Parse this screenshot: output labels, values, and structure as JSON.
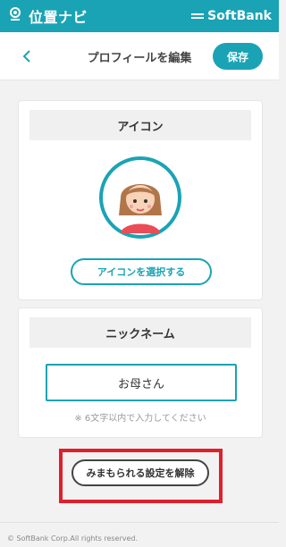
{
  "app_bar": {
    "brand": "位置ナビ",
    "partner": "SoftBank",
    "icons": {
      "pin": "location-pin-icon",
      "logo": "softbank-lines-icon"
    }
  },
  "header": {
    "back_icon": "chevron-left-icon",
    "title": "プロフィールを編集",
    "save_label": "保存"
  },
  "icon_section": {
    "heading": "アイコン",
    "avatar": "girl-avatar-icon",
    "select_label": "アイコンを選択する"
  },
  "nickname_section": {
    "heading": "ニックネーム",
    "value": "お母さん",
    "hint": "※ 6文字以内で入力してください"
  },
  "actions": {
    "unmonitor_label": "みまもられる設定を解除"
  },
  "footer": {
    "copyright": "© SoftBank Corp.All rights reserved."
  },
  "colors": {
    "accent": "#1aa3b5",
    "highlight": "#e01f2d",
    "background": "#f2f2f2"
  }
}
